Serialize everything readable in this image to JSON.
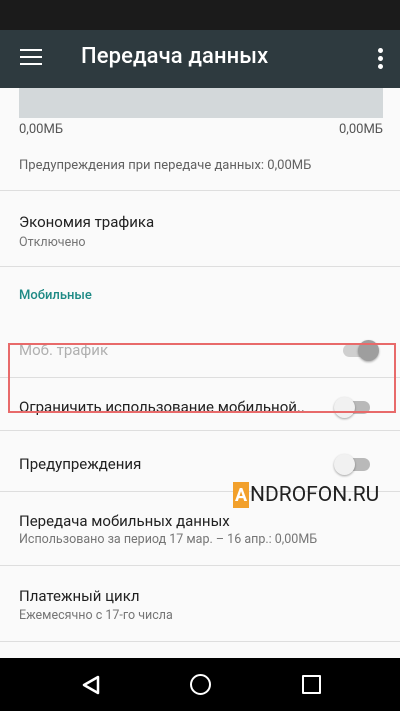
{
  "app_bar": {
    "title": "Передача данных"
  },
  "chart": {
    "left_label": "0,00МБ",
    "right_label": "0,00МБ"
  },
  "warning_info": "Предупреждения при передаче данных: 0,00МБ",
  "traffic_saving": {
    "title": "Экономия трафика",
    "subtitle": "Отключено"
  },
  "section_mobile": "Мобильные",
  "mobile_traffic": {
    "title": "Моб. трафик",
    "enabled": true,
    "disabled_state": true
  },
  "limit_usage": {
    "title": "Ограничить использование мобильной..",
    "enabled": false
  },
  "warnings": {
    "title": "Предупреждения",
    "enabled": false
  },
  "mobile_data_transfer": {
    "title": "Передача мобильных данных",
    "subtitle": "Использовано за период 17 мар. – 16 апр.: 0,00МБ"
  },
  "billing_cycle": {
    "title": "Платежный цикл",
    "subtitle": "Ежемесячно с 17-го числа"
  },
  "watermark": {
    "logo_letter": "A",
    "text": "NDROFON.RU"
  }
}
